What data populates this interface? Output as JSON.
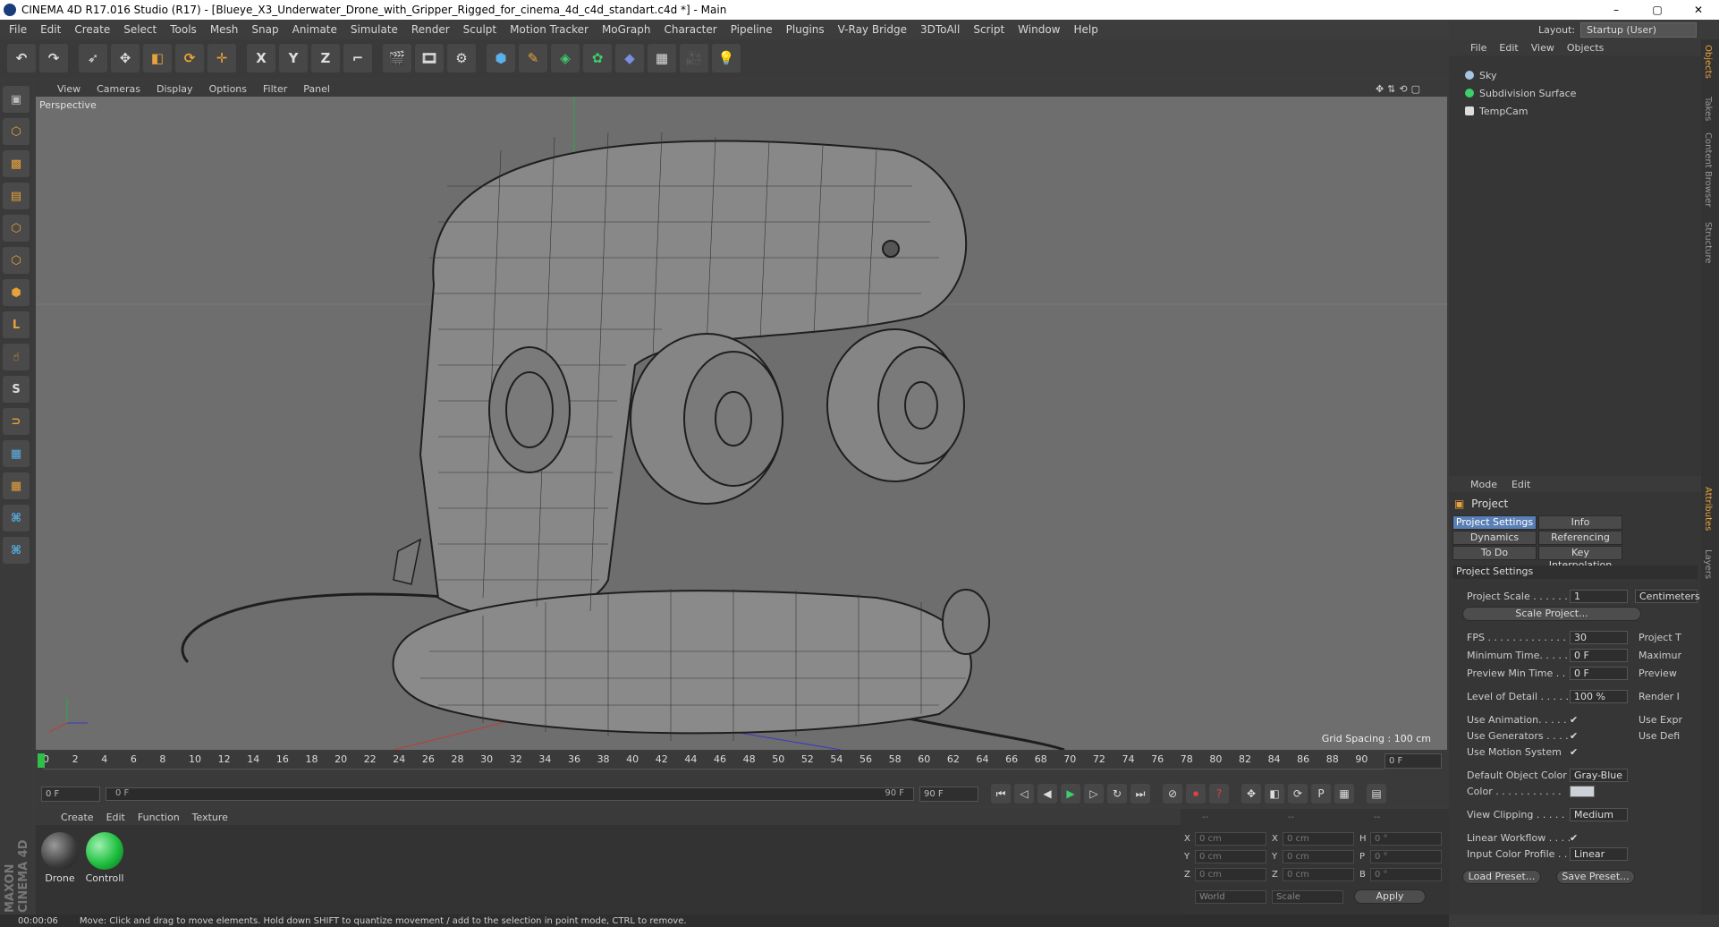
{
  "window": {
    "title": "CINEMA 4D R17.016 Studio (R17) - [Blueye_X3_Underwater_Drone_with_Gripper_Rigged_for_cinema_4d_c4d_standart.c4d *] - Main",
    "min": "–",
    "max": "▢",
    "close": "✕"
  },
  "menu": [
    "File",
    "Edit",
    "Create",
    "Select",
    "Tools",
    "Mesh",
    "Snap",
    "Animate",
    "Simulate",
    "Render",
    "Sculpt",
    "Motion Tracker",
    "MoGraph",
    "Character",
    "Pipeline",
    "Plugins",
    "V-Ray Bridge",
    "3DToAll",
    "Script",
    "Window",
    "Help"
  ],
  "layout": {
    "label": "Layout:",
    "value": "Startup (User)"
  },
  "toolbar": {
    "x": "X",
    "y": "Y",
    "z": "Z"
  },
  "viewport": {
    "menu": [
      "View",
      "Cameras",
      "Display",
      "Options",
      "Filter",
      "Panel"
    ],
    "label": "Perspective",
    "grid_spacing": "Grid Spacing : 100 cm"
  },
  "timeline": {
    "ticks": [
      "0",
      "2",
      "4",
      "6",
      "8",
      "10",
      "12",
      "14",
      "16",
      "18",
      "20",
      "22",
      "24",
      "26",
      "28",
      "30",
      "32",
      "34",
      "36",
      "38",
      "40",
      "42",
      "44",
      "46",
      "48",
      "50",
      "52",
      "54",
      "56",
      "58",
      "60",
      "62",
      "64",
      "66",
      "68",
      "70",
      "72",
      "74",
      "76",
      "78",
      "80",
      "82",
      "84",
      "86",
      "88",
      "90"
    ],
    "current": "0 F",
    "start": "0 F",
    "range_start": "0 F",
    "range_end": "90 F",
    "end": "90 F"
  },
  "materials": {
    "menu": [
      "Create",
      "Edit",
      "Function",
      "Texture"
    ],
    "items": [
      {
        "label": "Drone",
        "color": "#3a3a3a"
      },
      {
        "label": "Controll",
        "color": "#1fbf3f"
      }
    ]
  },
  "coords": {
    "x": "0 cm",
    "y": "0 cm",
    "z": "0 cm",
    "x2": "0 cm",
    "y2": "0 cm",
    "z2": "0 cm",
    "h": "0 °",
    "p": "0 °",
    "b": "0 °",
    "world": "World",
    "scale": "Scale",
    "apply": "Apply",
    "dashes": "--"
  },
  "status": {
    "time": "00:00:06",
    "message": "Move: Click and drag to move elements. Hold down SHIFT to quantize movement / add to the selection in point mode, CTRL to remove."
  },
  "objects": {
    "menu": [
      "File",
      "Edit",
      "View",
      "Objects"
    ],
    "items": [
      "Sky",
      "Subdivision Surface",
      "TempCam"
    ]
  },
  "attributes": {
    "menu": [
      "Mode",
      "Edit"
    ],
    "title": "Project",
    "tabs": [
      "Project Settings",
      "Info",
      "Dynamics",
      "Referencing",
      "To Do",
      "Key Interpolation"
    ],
    "section": "Project Settings",
    "scale_label": "Project Scale . . . . . .",
    "scale_value": "1",
    "scale_unit": "Centimeters",
    "scale_btn": "Scale Project...",
    "rows": [
      {
        "label": "FPS . . . . . . . . . . . . . .",
        "value": "30"
      },
      {
        "label": "Minimum Time. . . . .",
        "value": "0 F"
      },
      {
        "label": "Preview Min Time . .",
        "value": "0 F"
      },
      {
        "label": "Level of Detail . . . . .",
        "value": "100 %"
      }
    ],
    "right_labels": [
      "Project T",
      "Maximur",
      "Preview",
      "Render I",
      "Use Expr",
      "Use Defi"
    ],
    "checks": [
      "Use Animation. . . . .",
      "Use Generators . . . .",
      "Use Motion System"
    ],
    "default_color_label": "Default Object Color",
    "default_color_value": "Gray-Blue",
    "color_label": "Color . . . . . . . . . . .",
    "clipping_label": "View Clipping . . . . .",
    "clipping_value": "Medium",
    "linear_label": "Linear Workflow . . . .",
    "profile_label": "Input Color Profile . .",
    "profile_value": "Linear",
    "load_preset": "Load Preset...",
    "save_preset": "Save Preset..."
  },
  "side_tabs": [
    "Objects",
    "Takes",
    "Content Browser",
    "Structure",
    "Attributes",
    "Layers"
  ],
  "brand": "MAXON CINEMA 4D"
}
